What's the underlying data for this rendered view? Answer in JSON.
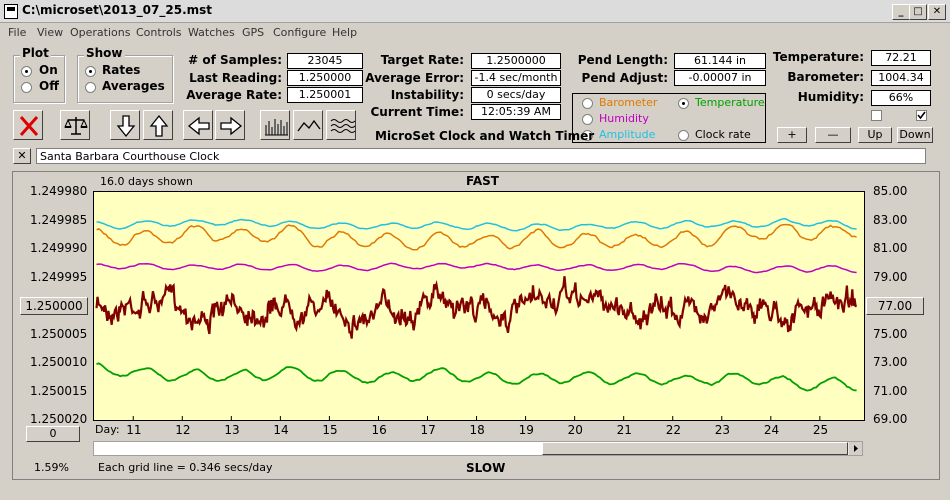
{
  "window": {
    "title": "C:\\microset\\2013_07_25.mst",
    "min": "_",
    "max": "□",
    "close": "✕"
  },
  "menu": [
    "File",
    "View",
    "Operations",
    "Controls",
    "Watches",
    "GPS",
    "Configure",
    "Help"
  ],
  "plot_group": {
    "label": "Plot",
    "options": [
      "On",
      "Off"
    ],
    "selected": "On"
  },
  "show_group": {
    "label": "Show",
    "options": [
      "Rates",
      "Averages"
    ],
    "selected": "Rates"
  },
  "stats": {
    "samples_label": "# of Samples:",
    "samples": "23045",
    "last_label": "Last Reading:",
    "last": "1.250000",
    "avg_label": "Average Rate:",
    "avg": "1.250001"
  },
  "targets": {
    "target_label": "Target Rate:",
    "target": "1.2500000",
    "error_label": "Average Error:",
    "error": "-1.4 sec/month",
    "instability_label": "Instability:",
    "instability": "0 secs/day",
    "time_label": "Current Time:",
    "time": "12:05:39 AM"
  },
  "app_name": "MicroSet Clock and Watch Timer",
  "pendulum": {
    "length_label": "Pend Length:",
    "length": "61.144 in",
    "adjust_label": "Pend Adjust:",
    "adjust": "-0.00007 in"
  },
  "sensors": {
    "temp_label": "Temperature:",
    "temp": "72.21",
    "baro_label": "Barometer:",
    "baro": "1004.34",
    "hum_label": "Humidity:",
    "hum": "66%"
  },
  "aux_plot": {
    "options": [
      {
        "label": "Barometer",
        "color": "#e07800",
        "selected": false
      },
      {
        "label": "Temperature",
        "color": "#00a000",
        "selected": true
      },
      {
        "label": "Humidity",
        "color": "#c000c0",
        "selected": false
      },
      {
        "label": "Amplitude",
        "color": "#20c0e0",
        "selected": false
      },
      {
        "label": "Clock rate",
        "color": "#000000",
        "selected": false
      }
    ]
  },
  "scale_buttons": {
    "plus": "+",
    "minus": "—",
    "up": "Up",
    "down": "Down"
  },
  "clock_name": "Santa Barbara Courthouse Clock",
  "close_x": "✕",
  "chart_header": {
    "days_shown": "16.0 days shown",
    "fast": "FAST",
    "slow": "SLOW",
    "grid_note": "Each grid line = 0.346 secs/day",
    "percent": "1.59%",
    "day_label": "Day:"
  },
  "center_button": "1.250000",
  "right_button": "77.00",
  "zero_button": "0",
  "chart_data": {
    "type": "line",
    "x_label": "Day:",
    "x_ticks": [
      11,
      12,
      13,
      14,
      15,
      16,
      17,
      18,
      19,
      20,
      21,
      22,
      23,
      24,
      25
    ],
    "xlim": [
      10.2,
      25.9
    ],
    "left_axis": {
      "ticks": [
        "1.249980",
        "1.249985",
        "1.249990",
        "1.249995",
        "1.250000",
        "1.250005",
        "1.250010",
        "1.250015",
        "1.250020"
      ],
      "ylim": [
        1.24998,
        1.25002
      ],
      "inverted": true
    },
    "right_axis": {
      "ticks": [
        "85.00",
        "83.00",
        "81.00",
        "79.00",
        "77.00",
        "75.00",
        "73.00",
        "71.00",
        "69.00"
      ],
      "ylim": [
        69,
        85
      ]
    },
    "series": [
      {
        "name": "Clock rate",
        "color": "#800000",
        "axis": "left",
        "base": 1.25,
        "amp": 2.5e-06,
        "width": 2.2,
        "noise": true
      },
      {
        "name": "Temperature",
        "color": "#00a000",
        "axis": "right",
        "base": 72.6,
        "amp": 0.6,
        "width": 1.8,
        "trend": -0.08
      },
      {
        "name": "Humidity",
        "color": "#c000c0",
        "axis": "right",
        "base": 79.7,
        "amp": 0.3,
        "width": 1.5
      },
      {
        "name": "Barometer",
        "color": "#e07800",
        "axis": "right",
        "base": 81.8,
        "amp": 0.9,
        "width": 1.5
      },
      {
        "name": "Amplitude",
        "color": "#20c0e0",
        "axis": "right",
        "base": 82.7,
        "amp": 0.35,
        "width": 1.5
      }
    ],
    "grid": false
  }
}
